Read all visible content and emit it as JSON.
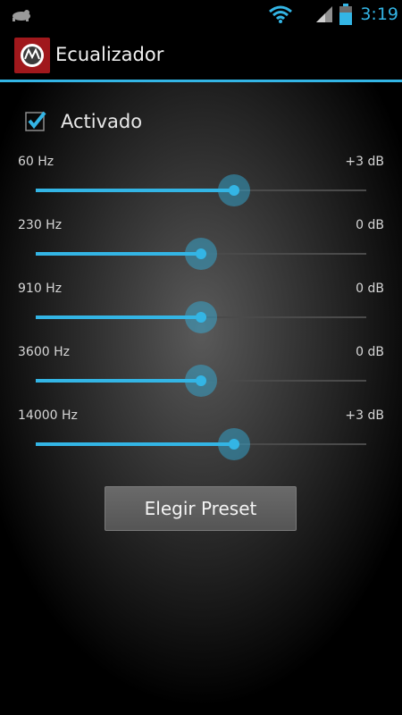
{
  "status_bar": {
    "time": "3:19",
    "icons": [
      "notification-icon",
      "wifi-icon",
      "signal-icon",
      "battery-icon"
    ]
  },
  "action_bar": {
    "title": "Ecualizador",
    "app_icon": "equalizer-app-icon"
  },
  "enable": {
    "label": "Activado",
    "checked": true
  },
  "bands": [
    {
      "freq": "60 Hz",
      "gain": "+3 dB",
      "level": 0.6
    },
    {
      "freq": "230 Hz",
      "gain": "0 dB",
      "level": 0.5
    },
    {
      "freq": "910 Hz",
      "gain": "0 dB",
      "level": 0.5
    },
    {
      "freq": "3600 Hz",
      "gain": "0 dB",
      "level": 0.5
    },
    {
      "freq": "14000 Hz",
      "gain": "+3 dB",
      "level": 0.6
    }
  ],
  "preset_button": {
    "label": "Elegir Preset"
  },
  "colors": {
    "accent": "#33b5e5",
    "background": "#000000",
    "app_icon_bg": "#a0181c",
    "button_bg": "#5e5e5e"
  }
}
